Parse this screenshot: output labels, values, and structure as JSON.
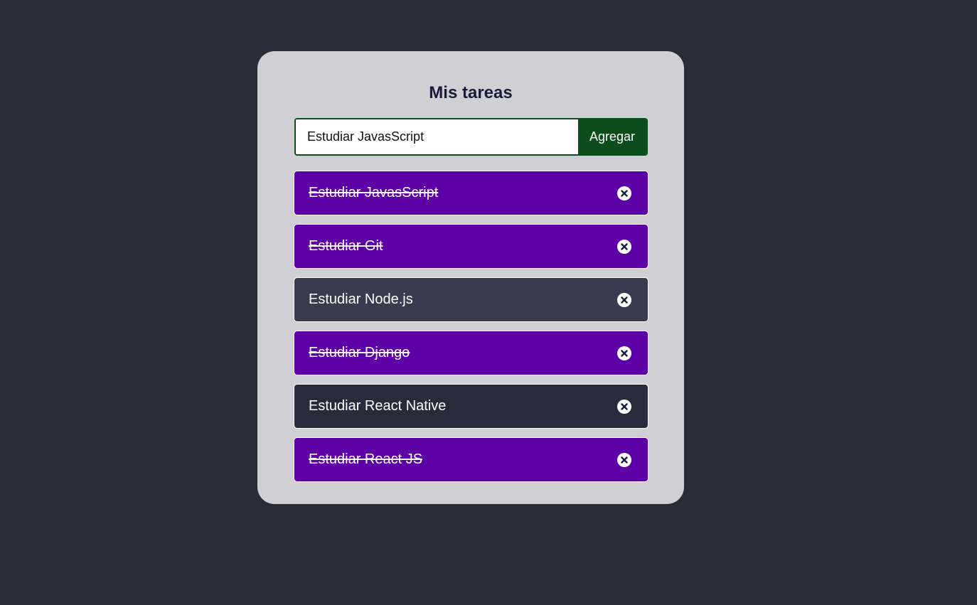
{
  "app": {
    "title": "Mis tareas"
  },
  "form": {
    "input_value": "Estudiar JavasScript",
    "add_label": "Agregar"
  },
  "colors": {
    "background": "#282c34",
    "card": "#d0cfd4",
    "completed": "#5d00a6",
    "button": "#0c4d1c"
  },
  "tasks": [
    {
      "text": "Estudiar JavasScript",
      "completed": true,
      "delete_icon": "circle-x-icon"
    },
    {
      "text": "Estudiar Git",
      "completed": true,
      "delete_icon": "circle-x-icon"
    },
    {
      "text": "Estudiar Node.js",
      "completed": false,
      "delete_icon": "circle-x-icon"
    },
    {
      "text": "Estudiar Django",
      "completed": true,
      "delete_icon": "circle-x-icon"
    },
    {
      "text": "Estudiar React Native",
      "completed": false,
      "delete_icon": "circle-x-icon"
    },
    {
      "text": "Estudiar React JS",
      "completed": true,
      "delete_icon": "circle-x-icon"
    }
  ]
}
